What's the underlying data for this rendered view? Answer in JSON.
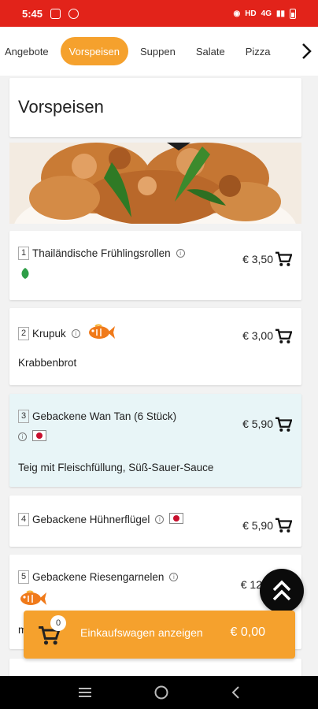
{
  "status": {
    "time": "5:45",
    "network": "4G"
  },
  "tabs": [
    {
      "label": "Angebote",
      "active": false
    },
    {
      "label": "Vorspeisen",
      "active": true
    },
    {
      "label": "Suppen",
      "active": false
    },
    {
      "label": "Salate",
      "active": false
    },
    {
      "label": "Pizza",
      "active": false
    }
  ],
  "section": {
    "title": "Vorspeisen"
  },
  "items": [
    {
      "num": "1",
      "name": "Thailändische Frühlingsrollen",
      "price": "€ 3,50",
      "desc": "",
      "badge": "leaf-icon"
    },
    {
      "num": "2",
      "name": "Krupuk",
      "price": "€ 3,00",
      "desc": "Krabbenbrot",
      "badge": "fish-icon"
    },
    {
      "num": "3",
      "name": "Gebackene Wan Tan (6 Stück)",
      "price": "€ 5,90",
      "desc": "Teig mit Fleischfüllung, Süß-Sauer-Sauce",
      "badge": "flag-icon"
    },
    {
      "num": "4",
      "name": "Gebackene Hühnerflügel",
      "price": "€ 5,90",
      "desc": "",
      "badge": "flag-icon"
    },
    {
      "num": "5",
      "name": "Gebackene Riesengarnelen",
      "price": "€ 12",
      "desc": "m",
      "badge": "fish-icon"
    }
  ],
  "cart": {
    "count": "0",
    "label": "Einkaufswagen anzeigen",
    "total": "€ 0,00"
  },
  "colors": {
    "statusbar": "#e2231a",
    "accent": "#f5a12d",
    "highlight": "#e8f5f7"
  }
}
